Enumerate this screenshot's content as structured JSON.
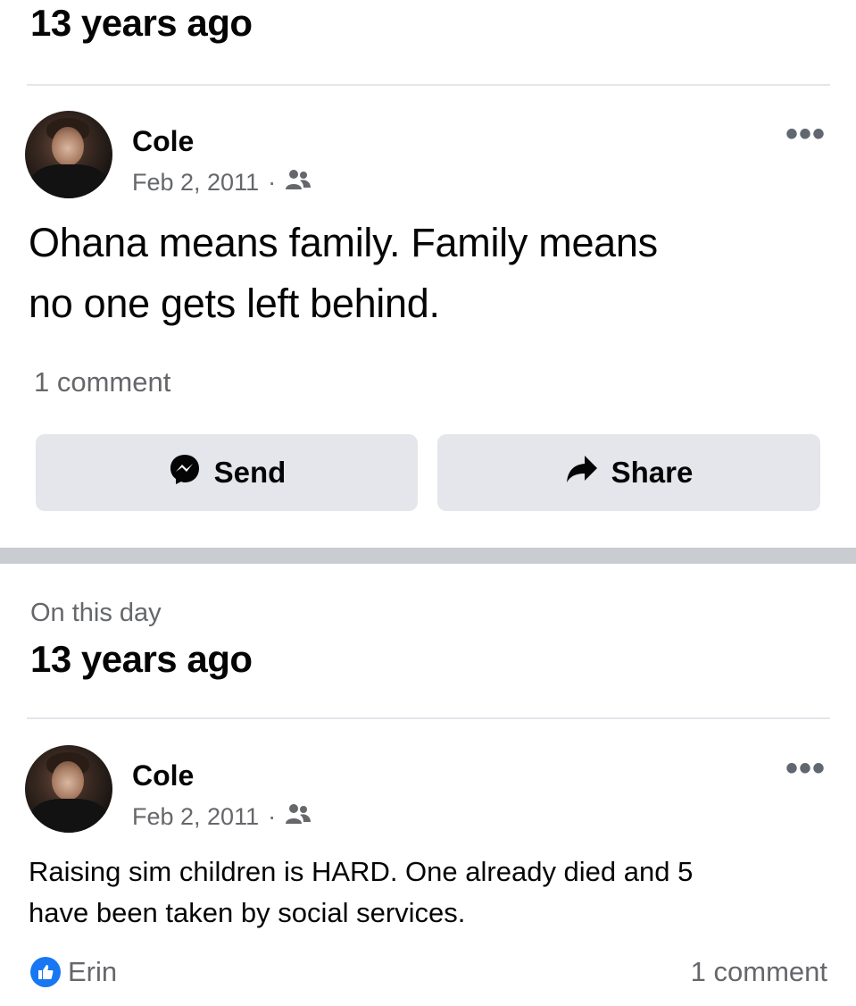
{
  "memory_top": {
    "heading": "13 years ago"
  },
  "post1": {
    "author": "Cole",
    "date": "Feb 2, 2011",
    "separator": "·",
    "audience_icon": "friends-icon",
    "more_icon": "more-icon",
    "text_line1": "Ohana means family. Family means",
    "text_line2": "no one gets left behind.",
    "comments": "1 comment",
    "actions": {
      "send_label": "Send",
      "send_icon": "messenger-icon",
      "share_label": "Share",
      "share_icon": "share-arrow-icon"
    }
  },
  "memory_second": {
    "label": "On this day",
    "heading": "13 years ago"
  },
  "post2": {
    "author": "Cole",
    "date": "Feb 2, 2011",
    "separator": "·",
    "audience_icon": "friends-icon",
    "more_icon": "more-icon",
    "text_line1": "Raising sim children is HARD. One already died and 5",
    "text_line2": "have been taken by social services.",
    "reaction_icon": "like-icon",
    "reaction_name": "Erin",
    "comments": "1 comment"
  },
  "colors": {
    "background": "#ffffff",
    "button_bg": "#e4e6eb",
    "separator": "#c9ccd1",
    "muted_text": "#65676b",
    "like_blue": "#1877f2"
  }
}
